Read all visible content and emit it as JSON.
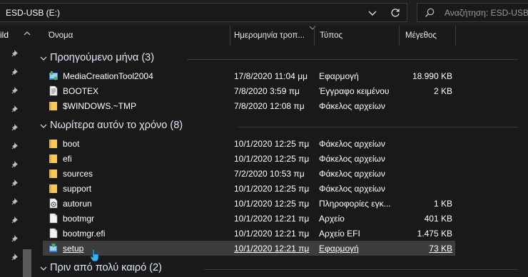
{
  "address": {
    "path": "ESD-USB (E:)"
  },
  "search": {
    "placeholder": "Αναζήτηση: ESD-USB"
  },
  "nav": {
    "title": "ild"
  },
  "columns": {
    "name": "Όνομα",
    "date": "Ημερομηνία τροπ...",
    "type": "Τύπος",
    "size": "Μέγεθος"
  },
  "groups": [
    {
      "label": "Προηγούμενο μήνα (3)",
      "rows": [
        {
          "icon": "media-creation-app-icon",
          "name": "MediaCreationTool2004",
          "date": "17/8/2020 11:04 μμ",
          "type": "Εφαρμογή",
          "size": "18.990 KB"
        },
        {
          "icon": "text-document-icon",
          "name": "BOOTEX",
          "date": "7/8/2020 3:59 πμ",
          "type": "Έγγραφο κειμένου",
          "size": "2 KB"
        },
        {
          "icon": "folder-icon",
          "name": "$WINDOWS.~TMP",
          "date": "7/8/2020 12:08 πμ",
          "type": "Φάκελος αρχείων",
          "size": ""
        }
      ]
    },
    {
      "label": "Νωρίτερα αυτόν το χρόνο (8)",
      "rows": [
        {
          "icon": "folder-icon",
          "name": "boot",
          "date": "10/1/2020 12:25 πμ",
          "type": "Φάκελος αρχείων",
          "size": ""
        },
        {
          "icon": "folder-icon",
          "name": "efi",
          "date": "10/1/2020 12:25 πμ",
          "type": "Φάκελος αρχείων",
          "size": ""
        },
        {
          "icon": "folder-icon",
          "name": "sources",
          "date": "7/2/2020 10:53 πμ",
          "type": "Φάκελος αρχείων",
          "size": ""
        },
        {
          "icon": "folder-icon",
          "name": "support",
          "date": "10/1/2020 12:25 πμ",
          "type": "Φάκελος αρχείων",
          "size": ""
        },
        {
          "icon": "setup-info-icon",
          "name": "autorun",
          "date": "10/1/2020 12:25 πμ",
          "type": "Πληροφορίες εγκ...",
          "size": "1 KB"
        },
        {
          "icon": "file-icon",
          "name": "bootmgr",
          "date": "10/1/2020 12:21 πμ",
          "type": "Αρχείο",
          "size": "401 KB"
        },
        {
          "icon": "file-icon",
          "name": "bootmgr.efi",
          "date": "10/1/2020 12:21 πμ",
          "type": "Αρχείο EFI",
          "size": "1.475 KB"
        },
        {
          "icon": "setup-app-icon",
          "name": "setup",
          "date": "10/1/2020 12:21 πμ",
          "type": "Εφαρμογή",
          "size": "73 KB",
          "selected": true
        }
      ]
    },
    {
      "label": "Πριν από πολύ καιρό (2)",
      "rows": []
    }
  ],
  "colors": {
    "folder": "#f7c95c",
    "accent": "#2f9bd6",
    "selected_row": "#3d3d3d"
  }
}
